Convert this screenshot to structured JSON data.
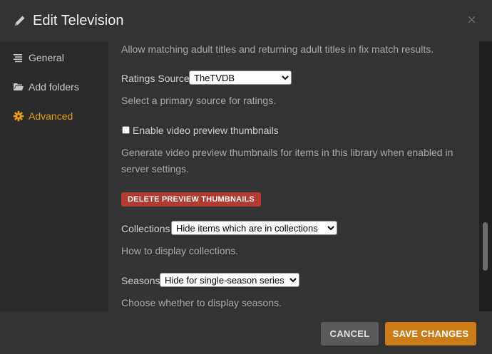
{
  "header": {
    "title": "Edit Television",
    "close_glyph": "×"
  },
  "sidebar": {
    "items": [
      {
        "label": "General",
        "icon": "list-icon",
        "active": false
      },
      {
        "label": "Add folders",
        "icon": "folder-icon",
        "active": false
      },
      {
        "label": "Advanced",
        "icon": "gear-icon",
        "active": true
      }
    ]
  },
  "content": {
    "adult_help": "Allow matching adult titles and returning adult titles in fix match results.",
    "ratings_source": {
      "label": "Ratings Source",
      "value": "TheTVDB",
      "help": "Select a primary source for ratings."
    },
    "video_preview": {
      "label": "Enable video preview thumbnails",
      "checked": false,
      "help_line1": "Generate video preview thumbnails for items in this library when enabled in",
      "help_line2": "server settings."
    },
    "delete_button": "DELETE PREVIEW THUMBNAILS",
    "collections": {
      "label": "Collections",
      "value": "Hide items which are in collections",
      "help": "How to display collections."
    },
    "seasons": {
      "label": "Seasons",
      "value": "Hide for single-season series",
      "help": "Choose whether to display seasons."
    }
  },
  "footer": {
    "cancel": "CANCEL",
    "save": "SAVE CHANGES"
  },
  "colors": {
    "accent": "#e5a00d",
    "save": "#cc7b19",
    "danger": "#b33a2e"
  }
}
